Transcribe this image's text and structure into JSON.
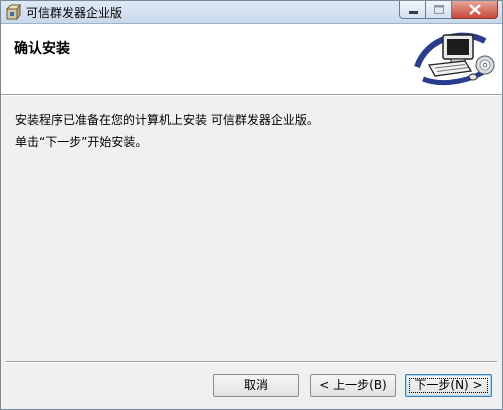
{
  "window": {
    "title": "可信群发器企业版",
    "icon": "installer-box-icon",
    "controls": {
      "minimize": "minimize-icon",
      "maximize": "maximize-icon",
      "close": "close-icon"
    }
  },
  "header": {
    "heading": "确认安装",
    "banner_icon": "computer-with-cd-icon"
  },
  "body": {
    "line1": "安装程序已准备在您的计算机上安装 可信群发器企业版。",
    "line2": "单击“下一步”开始安装。"
  },
  "buttons": {
    "cancel": "取消",
    "back": "< 上一步(B)",
    "next": "下一步(N) >"
  },
  "colors": {
    "window_bg": "#f0f0f0",
    "header_bg": "#ffffff",
    "close_button": "#c7483a"
  }
}
